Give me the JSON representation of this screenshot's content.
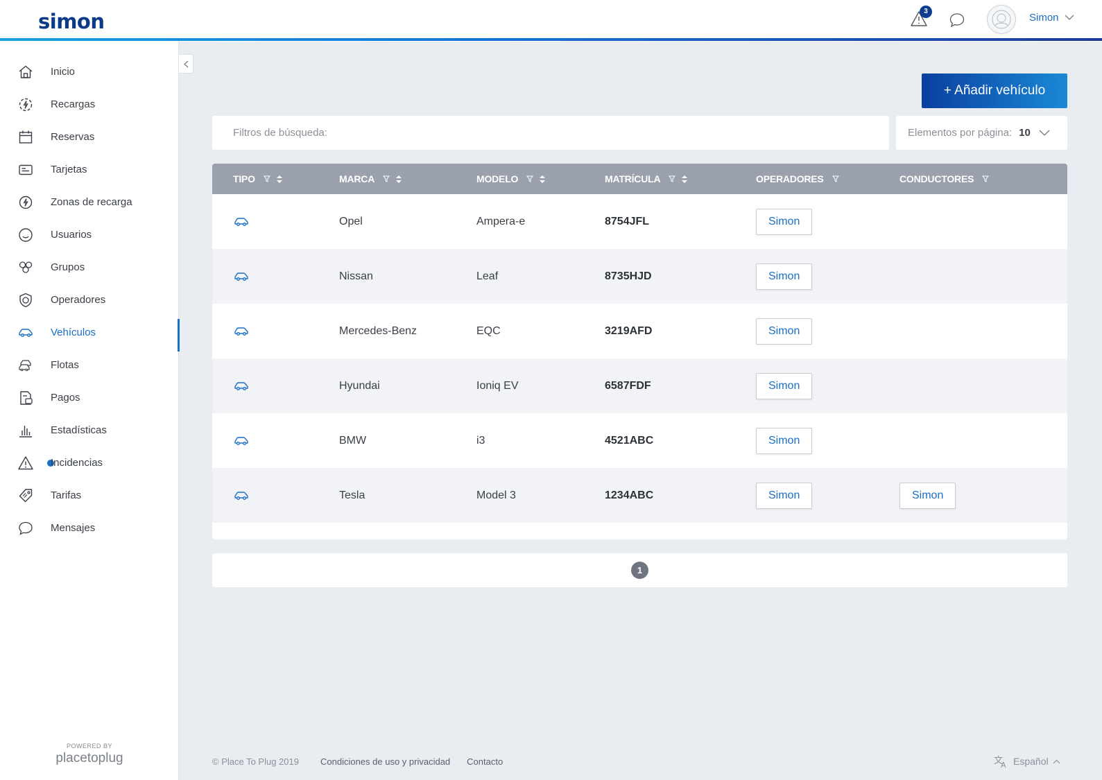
{
  "header": {
    "logo": "simon",
    "alert_count": "3",
    "user_name": "Simon"
  },
  "sidebar": {
    "items": [
      {
        "label": "Inicio",
        "icon": "home-icon"
      },
      {
        "label": "Recargas",
        "icon": "charge-icon"
      },
      {
        "label": "Reservas",
        "icon": "calendar-icon"
      },
      {
        "label": "Tarjetas",
        "icon": "card-icon"
      },
      {
        "label": "Zonas de recarga",
        "icon": "bolt-icon"
      },
      {
        "label": "Usuarios",
        "icon": "smile-icon"
      },
      {
        "label": "Grupos",
        "icon": "group-icon"
      },
      {
        "label": "Operadores",
        "icon": "shield-icon"
      },
      {
        "label": "Vehículos",
        "icon": "car-icon",
        "active": true
      },
      {
        "label": "Flotas",
        "icon": "fleet-icon"
      },
      {
        "label": "Pagos",
        "icon": "payments-icon"
      },
      {
        "label": "Estadísticas",
        "icon": "stats-icon"
      },
      {
        "label": "Incidencias",
        "icon": "warning-icon",
        "dot": true
      },
      {
        "label": "Tarifas",
        "icon": "tag-icon"
      },
      {
        "label": "Mensajes",
        "icon": "chat-icon"
      }
    ],
    "powered_by": "POWERED BY",
    "powered_brand": "placetoplug"
  },
  "toolbar": {
    "add_label": "+ Añadir vehículo"
  },
  "filters": {
    "placeholder": "Filtros de búsqueda:",
    "perpage_label": "Elementos por página:",
    "perpage_value": "10"
  },
  "table": {
    "headers": {
      "tipo": "TIPO",
      "marca": "MARCA",
      "modelo": "MODELO",
      "matricula": "MATRÍCULA",
      "operadores": "OPERADORES",
      "conductores": "CONDUCTORES"
    },
    "rows": [
      {
        "marca": "Opel",
        "modelo": "Ampera-e",
        "matricula": "8754JFL",
        "operador": "Simon",
        "conductor": ""
      },
      {
        "marca": "Nissan",
        "modelo": "Leaf",
        "matricula": "8735HJD",
        "operador": "Simon",
        "conductor": ""
      },
      {
        "marca": "Mercedes-Benz",
        "modelo": "EQC",
        "matricula": "3219AFD",
        "operador": "Simon",
        "conductor": ""
      },
      {
        "marca": "Hyundai",
        "modelo": "Ioniq EV",
        "matricula": "6587FDF",
        "operador": "Simon",
        "conductor": ""
      },
      {
        "marca": "BMW",
        "modelo": "i3",
        "matricula": "4521ABC",
        "operador": "Simon",
        "conductor": ""
      },
      {
        "marca": "Tesla",
        "modelo": "Model 3",
        "matricula": "1234ABC",
        "operador": "Simon",
        "conductor": "Simon"
      }
    ]
  },
  "pagination": {
    "current_page": "1"
  },
  "footer": {
    "copyright": "© Place To Plug 2019",
    "terms": "Condiciones de uso y privacidad",
    "contact": "Contacto",
    "language": "Español"
  },
  "colors": {
    "accent": "#1a6fc7",
    "brand": "#0b3a88",
    "table_header": "#9aa1ad"
  }
}
